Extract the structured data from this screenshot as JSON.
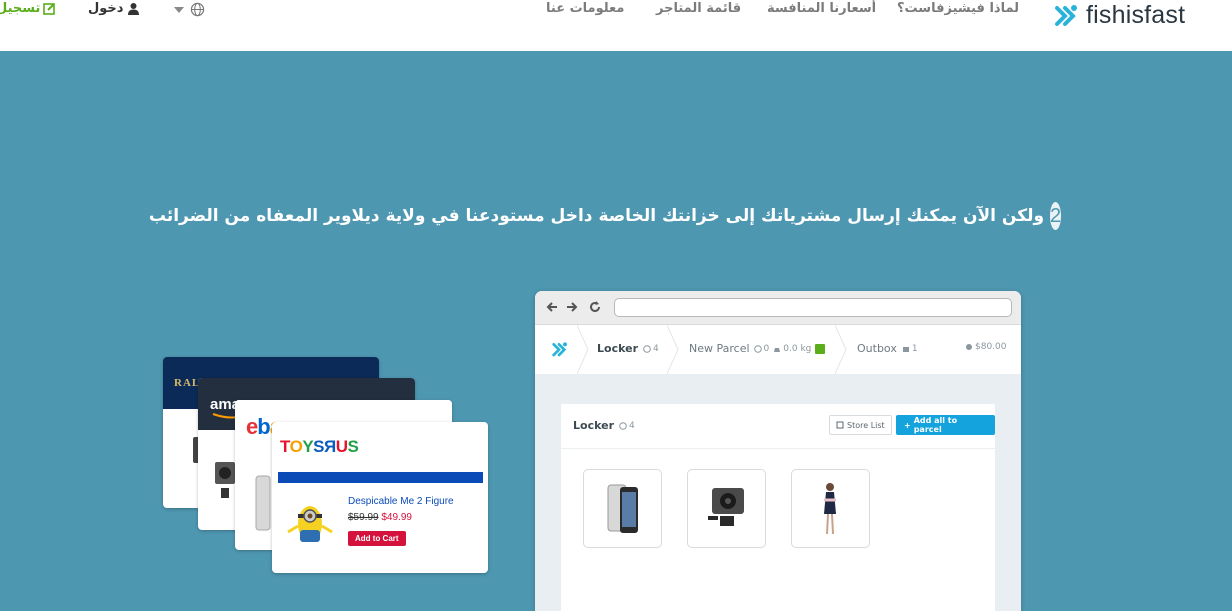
{
  "nav": {
    "brand": "fishisfast",
    "links": [
      "لماذا فيشيزفاست؟",
      "أسعارنا المنافسة",
      "قائمة المتاجر",
      "معلومات عنا"
    ],
    "login": "دخول",
    "register": "تسجيل",
    "globe_icon": "globe-icon",
    "colors": {
      "register": "#5aae1a",
      "brand": "#2a3640"
    }
  },
  "hero": {
    "step": "2",
    "headline": "ولكن الآن يمكنك إرسال مشترياتك إلى خزانتك الخاصة داخل مستودعنا في ولاية ديلاوير المعفاه من الضرائب",
    "background": "#4e97b1"
  },
  "stores": {
    "ralph": "RALPH",
    "amazon": "amazon",
    "ebay": "ebay",
    "toysrus_logo": "ToysRus",
    "product_name": "Despicable Me 2 Figure",
    "old_price": "$59.99",
    "new_price": "$49.99",
    "add_to_cart": "Add to Cart"
  },
  "app": {
    "tabs": {
      "locker": "Locker",
      "locker_count": "4",
      "new_parcel": "New Parcel",
      "new_parcel_count": "0",
      "new_parcel_weight": "0.0 kg",
      "outbox": "Outbox",
      "outbox_count": "1",
      "balance": "$80.00"
    },
    "panel": {
      "title": "Locker",
      "count": "4",
      "store_list": "Store List",
      "add_all": "Add all to parcel"
    }
  }
}
